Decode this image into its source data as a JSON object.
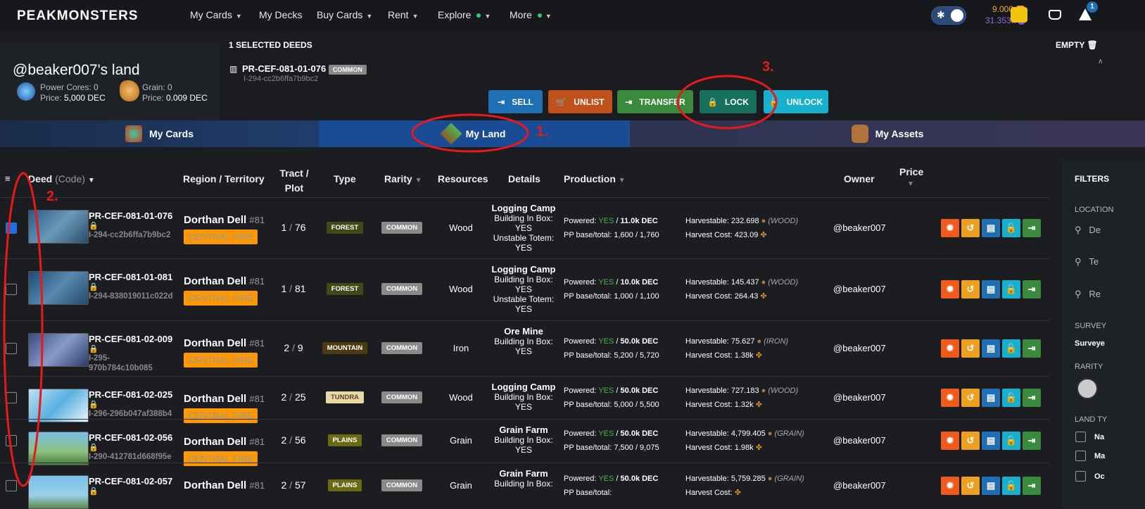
{
  "nav": {
    "logo": "PEAKMONSTERS",
    "items": [
      {
        "label": "My Cards",
        "chevron": true,
        "dot": false
      },
      {
        "label": "My Decks",
        "chevron": false,
        "dot": false
      },
      {
        "label": "Buy Cards",
        "chevron": true,
        "dot": false
      },
      {
        "label": "Rent",
        "chevron": true,
        "dot": false
      },
      {
        "label": "Explore",
        "chevron": true,
        "dot": true
      },
      {
        "label": "More",
        "chevron": true,
        "dot": true
      }
    ],
    "balance_dec": "9.000",
    "balance_sps": "31.353k",
    "notification_count": "1"
  },
  "land_header": {
    "title": "@beaker007's land",
    "power_cores": "Power Cores: 0",
    "power_price_label": "Price:",
    "power_price": "5,000 DEC",
    "grain": "Grain: 0",
    "grain_price_label": "Price:",
    "grain_price": "0.009 DEC"
  },
  "selection": {
    "header": "1 SELECTED DEEDS",
    "empty_label": "EMPTY",
    "deed_code": "PR-CEF-081-01-076",
    "deed_rarity": "COMMON",
    "deed_id": "I-294-cc2b6ffa7b9bc2",
    "actions": [
      {
        "label": "SELL",
        "icon": "sell-icon",
        "color": "#1f6fb5"
      },
      {
        "label": "UNLIST",
        "icon": "cart-icon",
        "color": "#c0501c"
      },
      {
        "label": "TRANSFER",
        "icon": "transfer-icon",
        "color": "#3a8a3e"
      },
      {
        "label": "LOCK",
        "icon": "lock-icon",
        "color": "#17705e"
      },
      {
        "label": "UNLOCK",
        "icon": "unlock-icon",
        "color": "#18b0cf"
      }
    ]
  },
  "tabs": [
    {
      "label": "My Cards",
      "icon": "cards-icon"
    },
    {
      "label": "My Land",
      "icon": "land-icon"
    },
    {
      "label": "My Assets",
      "icon": "backpack-icon"
    }
  ],
  "table": {
    "headers": {
      "deed": "Deed",
      "code": "(Code)",
      "region": "Region / Territory",
      "tract": "Tract /",
      "plot": "Plot",
      "type": "Type",
      "rarity": "Rarity",
      "resources": "Resources",
      "details": "Details",
      "production": "Production",
      "owner": "Owner",
      "price": "Price"
    },
    "rows": [
      {
        "code": "PR-CEF-081-01-076",
        "id": "I-294-cc2b6ffa7b9bc2",
        "region": "Dorthan Dell",
        "num": "#81",
        "territory": "CENTRAL FIRE",
        "tract": "1",
        "plot": "76",
        "type": "FOREST",
        "rarity": "COMMON",
        "resource": "Wood",
        "d1": "Logging Camp",
        "d2": "Building In Box:",
        "d3": "YES",
        "d4": "Unstable Totem:",
        "d5": "YES",
        "powered": "YES",
        "powered_val": "11.0k DEC",
        "pp": "1,600 / 1,760",
        "harvestable": "232.698",
        "harv_res": "(WOOD)",
        "harvest_cost": "423.09",
        "owner": "@beaker007",
        "checked": true
      },
      {
        "code": "PR-CEF-081-01-081",
        "id": "I-294-838019011c022d",
        "region": "Dorthan Dell",
        "num": "#81",
        "territory": "CENTRAL FIRE",
        "tract": "1",
        "plot": "81",
        "type": "FOREST",
        "rarity": "COMMON",
        "resource": "Wood",
        "d1": "Logging Camp",
        "d2": "Building In Box:",
        "d3": "YES",
        "d4": "Unstable Totem:",
        "d5": "YES",
        "powered": "YES",
        "powered_val": "10.0k DEC",
        "pp": "1,000 / 1,100",
        "harvestable": "145.437",
        "harv_res": "(WOOD)",
        "harvest_cost": "264.43",
        "owner": "@beaker007",
        "checked": false
      },
      {
        "code": "PR-CEF-081-02-009",
        "id": "I-295-970b784c10b085",
        "region": "Dorthan Dell",
        "num": "#81",
        "territory": "CENTRAL FIRE",
        "tract": "2",
        "plot": "9",
        "type": "MOUNTAIN",
        "rarity": "COMMON",
        "resource": "Iron",
        "d1": "Ore Mine",
        "d2": "Building In Box:",
        "d3": "YES",
        "d4": "",
        "d5": "",
        "powered": "YES",
        "powered_val": "50.0k DEC",
        "pp": "5,200 / 5,720",
        "harvestable": "75.627",
        "harv_res": "(IRON)",
        "harvest_cost": "1.38k",
        "owner": "@beaker007",
        "checked": false
      },
      {
        "code": "PR-CEF-081-02-025",
        "id": "I-296-296b047af388b4",
        "region": "Dorthan Dell",
        "num": "#81",
        "territory": "CENTRAL FIRE",
        "tract": "2",
        "plot": "25",
        "type": "TUNDRA",
        "rarity": "COMMON",
        "resource": "Wood",
        "d1": "Logging Camp",
        "d2": "Building In Box:",
        "d3": "YES",
        "d4": "",
        "d5": "",
        "powered": "YES",
        "powered_val": "50.0k DEC",
        "pp": "5,000 / 5,500",
        "harvestable": "727.183",
        "harv_res": "(WOOD)",
        "harvest_cost": "1.32k",
        "owner": "@beaker007",
        "checked": false
      },
      {
        "code": "PR-CEF-081-02-056",
        "id": "I-290-412781d668f95e",
        "region": "Dorthan Dell",
        "num": "#81",
        "territory": "CENTRAL FIRE",
        "tract": "2",
        "plot": "56",
        "type": "PLAINS",
        "rarity": "COMMON",
        "resource": "Grain",
        "d1": "Grain Farm",
        "d2": "Building In Box:",
        "d3": "YES",
        "d4": "",
        "d5": "",
        "powered": "YES",
        "powered_val": "50.0k DEC",
        "pp": "7,500 / 9,075",
        "harvestable": "4,799.405",
        "harv_res": "(GRAIN)",
        "harvest_cost": "1.98k",
        "owner": "@beaker007",
        "checked": false
      },
      {
        "code": "PR-CEF-081-02-057",
        "id": "",
        "region": "Dorthan Dell",
        "num": "#81",
        "territory": "",
        "tract": "2",
        "plot": "57",
        "type": "PLAINS",
        "rarity": "COMMON",
        "resource": "Grain",
        "d1": "Grain Farm",
        "d2": "Building In Box:",
        "d3": "",
        "d4": "",
        "d5": "",
        "powered": "YES",
        "powered_val": "50.0k DEC",
        "pp": "",
        "harvestable": "5,759.285",
        "harv_res": "(GRAIN)",
        "harvest_cost": "",
        "owner": "@beaker007",
        "checked": false
      }
    ],
    "prod_labels": {
      "powered": "Powered:",
      "pp": "PP base/total:",
      "harvestable": "Harvestable:",
      "harvest_cost": "Harvest Cost:"
    }
  },
  "filters": {
    "title": "FILTERS",
    "location": "LOCATION",
    "search1": "De",
    "search2": "Te",
    "search3": "Re",
    "survey": "SURVEY",
    "surveyed": "Surveye",
    "rarity": "RARITY",
    "land_type": "LAND TY",
    "opt1": "Na",
    "opt2": "Ma",
    "opt3": "Oc"
  },
  "annotations": {
    "a1": "1.",
    "a2": "2.",
    "a3": "3."
  },
  "colors": {
    "accent": "#1f6fb5",
    "red": "#e8191a",
    "orange": "#ff9800"
  }
}
